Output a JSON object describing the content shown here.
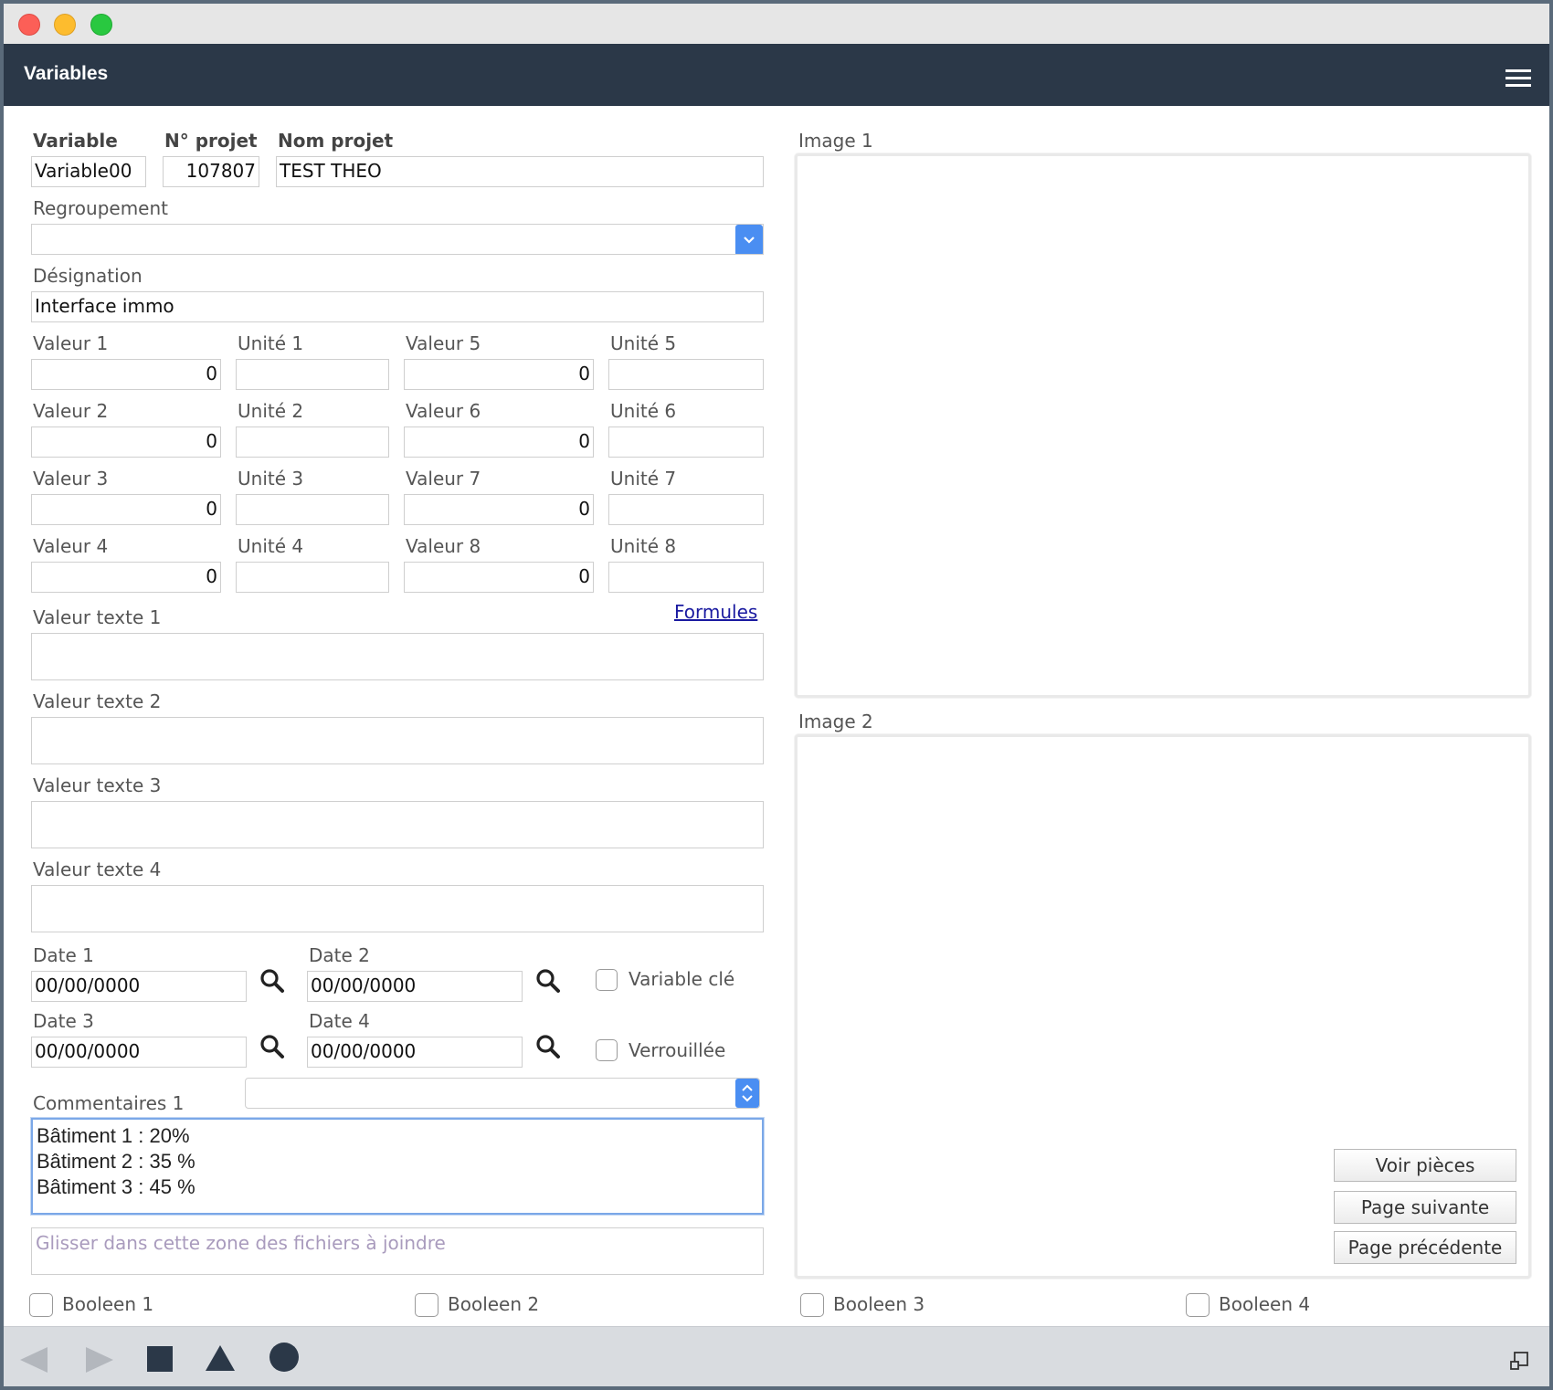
{
  "window": {
    "title": "Variables"
  },
  "form": {
    "variable_label": "Variable",
    "variable_value": "Variable00",
    "projet_num_label": "N° projet",
    "projet_num_value": "107807",
    "projet_nom_label": "Nom projet",
    "projet_nom_value": "TEST THEO",
    "regroupement_label": "Regroupement",
    "regroupement_value": "",
    "designation_label": "Désignation",
    "designation_value": "Interface immo",
    "valeurs": [
      {
        "label": "Valeur 1",
        "value": "0"
      },
      {
        "label": "Valeur 2",
        "value": "0"
      },
      {
        "label": "Valeur 3",
        "value": "0"
      },
      {
        "label": "Valeur 4",
        "value": "0"
      },
      {
        "label": "Valeur 5",
        "value": "0"
      },
      {
        "label": "Valeur 6",
        "value": "0"
      },
      {
        "label": "Valeur 7",
        "value": "0"
      },
      {
        "label": "Valeur 8",
        "value": "0"
      }
    ],
    "unites": [
      {
        "label": "Unité 1",
        "value": ""
      },
      {
        "label": "Unité 2",
        "value": ""
      },
      {
        "label": "Unité 3",
        "value": ""
      },
      {
        "label": "Unité 4",
        "value": ""
      },
      {
        "label": "Unité 5",
        "value": ""
      },
      {
        "label": "Unité 6",
        "value": ""
      },
      {
        "label": "Unité 7",
        "value": ""
      },
      {
        "label": "Unité 8",
        "value": ""
      }
    ],
    "formules_link": "Formules",
    "valeurs_texte": [
      {
        "label": "Valeur texte 1",
        "value": ""
      },
      {
        "label": "Valeur texte 2",
        "value": ""
      },
      {
        "label": "Valeur texte 3",
        "value": ""
      },
      {
        "label": "Valeur texte 4",
        "value": ""
      }
    ],
    "dates": [
      {
        "label": "Date 1",
        "value": "00/00/0000"
      },
      {
        "label": "Date 2",
        "value": "00/00/0000"
      },
      {
        "label": "Date 3",
        "value": "00/00/0000"
      },
      {
        "label": "Date 4",
        "value": "00/00/0000"
      }
    ],
    "variable_cle_label": "Variable clé",
    "verrouillee_label": "Verrouillée",
    "commentaires_label": "Commentaires 1",
    "commentaires_lines": [
      "Bâtiment 1 : 20%",
      "Bâtiment 2 : 35 %",
      "Bâtiment 3 : 45 %"
    ],
    "dropzone_placeholder": "Glisser dans cette zone des fichiers à joindre",
    "booleens": [
      "Booleen 1",
      "Booleen 2",
      "Booleen 3",
      "Booleen 4"
    ]
  },
  "images": {
    "image1_label": "Image 1",
    "image2_label": "Image 2"
  },
  "buttons": {
    "voir_pieces": "Voir pièces",
    "page_suivante": "Page suivante",
    "page_precedente": "Page précédente"
  },
  "toolbar": {
    "icons": [
      "back-arrow-icon",
      "forward-arrow-icon",
      "square-icon",
      "triangle-icon",
      "circle-icon",
      "resize-icon"
    ],
    "accent_color": "#2b3848"
  }
}
